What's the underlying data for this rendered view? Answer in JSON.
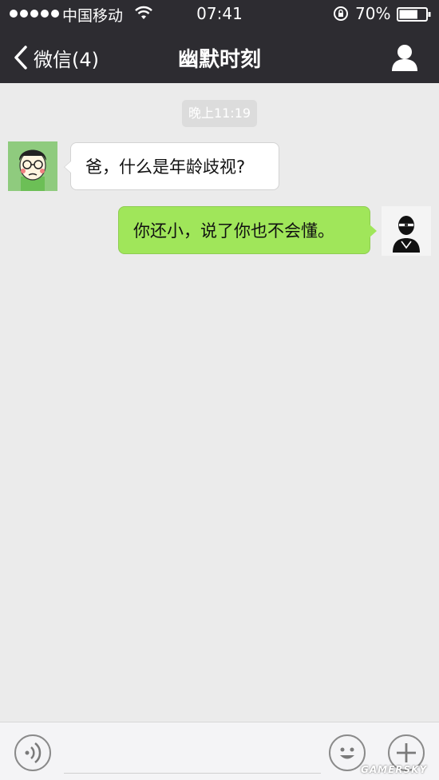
{
  "status_bar": {
    "carrier": "中国移动",
    "time": "07:41",
    "battery_percent": "70%",
    "battery_level": 0.7,
    "signal_dots": 5
  },
  "nav": {
    "back_label": "微信(4)",
    "title": "幽默时刻"
  },
  "chat": {
    "timestamp": "晚上11:19",
    "messages": [
      {
        "sender": "other",
        "text": "爸，什么是年龄歧视?"
      },
      {
        "sender": "me",
        "text": "你还小，说了你也不会懂。"
      }
    ]
  },
  "input_bar": {
    "value": "",
    "placeholder": ""
  },
  "watermark": "GAMERSKY",
  "colors": {
    "topbar": "#2d2c31",
    "chat_background": "#ebebeb",
    "my_bubble": "#a0e65a",
    "other_bubble": "#ffffff"
  }
}
